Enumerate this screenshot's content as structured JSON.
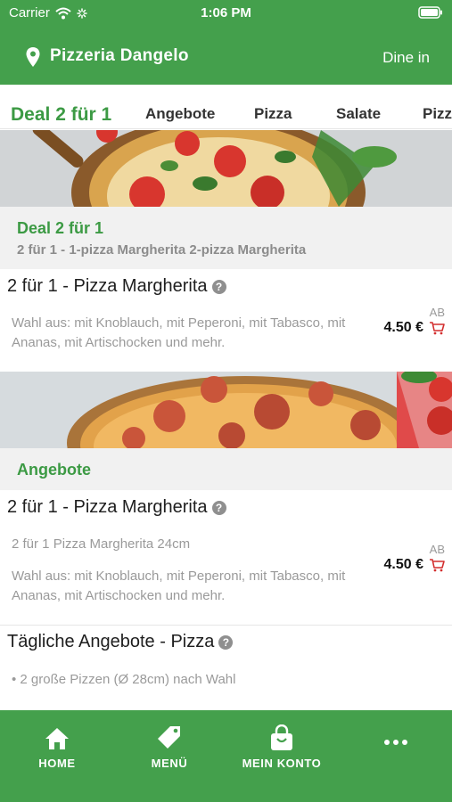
{
  "status_bar": {
    "carrier": "Carrier",
    "time": "1:06 PM"
  },
  "header": {
    "restaurant_name": "Pizzeria Dangelo",
    "mode_label": "Dine in",
    "location_icon": "location-pin-icon"
  },
  "category_tabs": [
    {
      "label": "Deal 2 für 1",
      "active": true
    },
    {
      "label": "Angebote",
      "active": false
    },
    {
      "label": "Pizza",
      "active": false
    },
    {
      "label": "Salate",
      "active": false
    },
    {
      "label": "Pizz",
      "active": false
    }
  ],
  "sections": [
    {
      "title": "Deal 2 für 1",
      "subtitle": "2 für 1 - 1-pizza Margherita 2-pizza Margherita",
      "items": [
        {
          "name": "2 für 1 - Pizza Margherita",
          "info_icon": "?",
          "description": "Wahl aus: mit Knoblauch, mit Peperoni, mit Tabasco, mit Ananas, mit Artischocken und mehr.",
          "price_prefix": "AB",
          "price": "4.50 €"
        }
      ]
    },
    {
      "title": "Angebote",
      "items": [
        {
          "name": "2 für 1 - Pizza Margherita",
          "info_icon": "?",
          "size_note": "2 für 1 Pizza Margherita 24cm",
          "description": "Wahl aus: mit Knoblauch, mit Peperoni, mit Tabasco, mit Ananas, mit Artischocken und mehr.",
          "price_prefix": "AB",
          "price": "4.50 €"
        },
        {
          "name": "Tägliche Angebote - Pizza",
          "info_icon": "?",
          "bullet": "• 2 große Pizzen (Ø 28cm) nach Wahl"
        }
      ]
    }
  ],
  "bottom_nav": [
    {
      "label": "HOME",
      "icon": "home-icon"
    },
    {
      "label": "MENÜ",
      "icon": "tag-icon"
    },
    {
      "label": "MEIN KONTO",
      "icon": "shopping-bag-icon"
    },
    {
      "label": "",
      "icon": "more-dots-icon"
    }
  ],
  "colors": {
    "brand_green": "#44a04c",
    "accent_green": "#3c9a44",
    "cart_red": "#d32f2f"
  }
}
